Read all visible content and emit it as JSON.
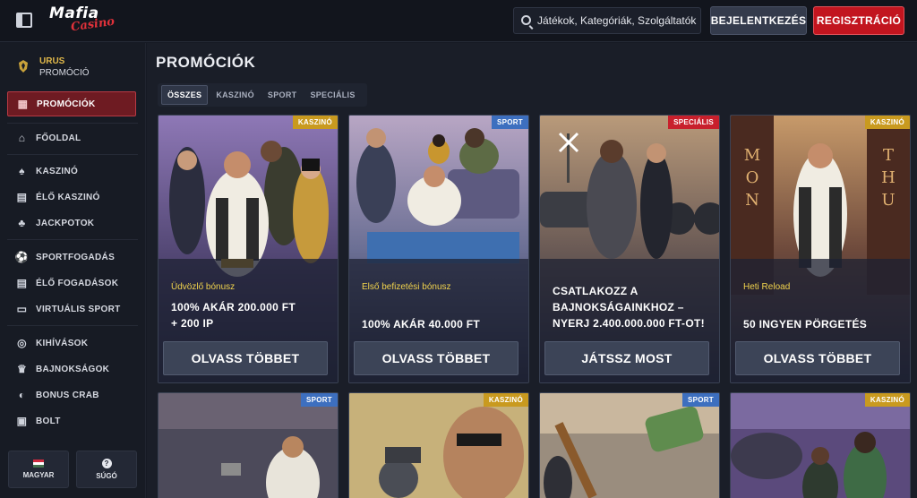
{
  "header": {
    "logo_main": "Mafia",
    "logo_sub": "Casino",
    "search_placeholder": "Játékok, Kategóriák, Szolgáltatók",
    "login_label": "BEJELENTKEZÉS",
    "register_label": "REGISZTRÁCIÓ"
  },
  "sidebar": {
    "promo_title": "URUS",
    "promo_sub": "PROMÓCIÓ",
    "items": [
      {
        "label": "PROMÓCIÓK",
        "icon": "gift-icon",
        "glyph": "▦"
      },
      {
        "label": "FŐOLDAL",
        "icon": "home-icon",
        "glyph": "⌂"
      },
      {
        "label": "KASZINÓ",
        "icon": "spade-icon",
        "glyph": "♠"
      },
      {
        "label": "ÉLŐ KASZINÓ",
        "icon": "live-casino-icon",
        "glyph": "▤"
      },
      {
        "label": "JACKPOTOK",
        "icon": "clover-icon",
        "glyph": "♣"
      },
      {
        "label": "SPORTFOGADÁS",
        "icon": "football-icon",
        "glyph": "⚽"
      },
      {
        "label": "ÉLŐ FOGADÁSOK",
        "icon": "live-bet-icon",
        "glyph": "▤"
      },
      {
        "label": "VIRTUÁLIS SPORT",
        "icon": "monitor-icon",
        "glyph": "▭"
      },
      {
        "label": "KIHÍVÁSOK",
        "icon": "target-icon",
        "glyph": "◎"
      },
      {
        "label": "BAJNOKSÁGOK",
        "icon": "trophy-icon",
        "glyph": "♛"
      },
      {
        "label": "BONUS CRAB",
        "icon": "crab-icon",
        "glyph": "◐"
      },
      {
        "label": "BOLT",
        "icon": "shop-icon",
        "glyph": "▣"
      }
    ],
    "language_label": "MAGYAR",
    "help_label": "SÚGÓ"
  },
  "main": {
    "title": "PROMÓCIÓK",
    "tabs": [
      "ÖSSZES",
      "KASZINÓ",
      "SPORT",
      "SPECIÁLIS"
    ],
    "cards": [
      {
        "badge": "KASZINÓ",
        "badge_type": "kaszino",
        "sub": "Üdvözlő bónusz",
        "line1": "100% AKÁR 200.000 FT",
        "line2": "+ 200 IP",
        "line3": "",
        "cta": "OLVASS TÖBBET"
      },
      {
        "badge": "SPORT",
        "badge_type": "sport",
        "sub": "Első befizetési bónusz",
        "line1": "100% AKÁR 40.000 FT",
        "line2": "",
        "line3": "",
        "cta": "OLVASS TÖBBET"
      },
      {
        "badge": "SPECIÁLIS",
        "badge_type": "specialis",
        "sub": "",
        "line1": "CSATLAKOZZ A",
        "line2": "BAJNOKSÁGAINKHOZ –",
        "line3": "NYERJ 2.400.000.000 FT-OT!",
        "cta": "JÁTSSZ MOST"
      },
      {
        "badge": "KASZINÓ",
        "badge_type": "kaszino",
        "sub": "Heti Reload",
        "line1": "50 INGYEN PÖRGETÉS",
        "line2": "",
        "line3": "",
        "cta": "OLVASS TÖBBET"
      }
    ],
    "bottom_cards": [
      {
        "badge": "SPORT",
        "badge_type": "sport"
      },
      {
        "badge": "KASZINÓ",
        "badge_type": "kaszino"
      },
      {
        "badge": "SPORT",
        "badge_type": "sport"
      },
      {
        "badge": "KASZINÓ",
        "badge_type": "kaszino"
      }
    ]
  }
}
